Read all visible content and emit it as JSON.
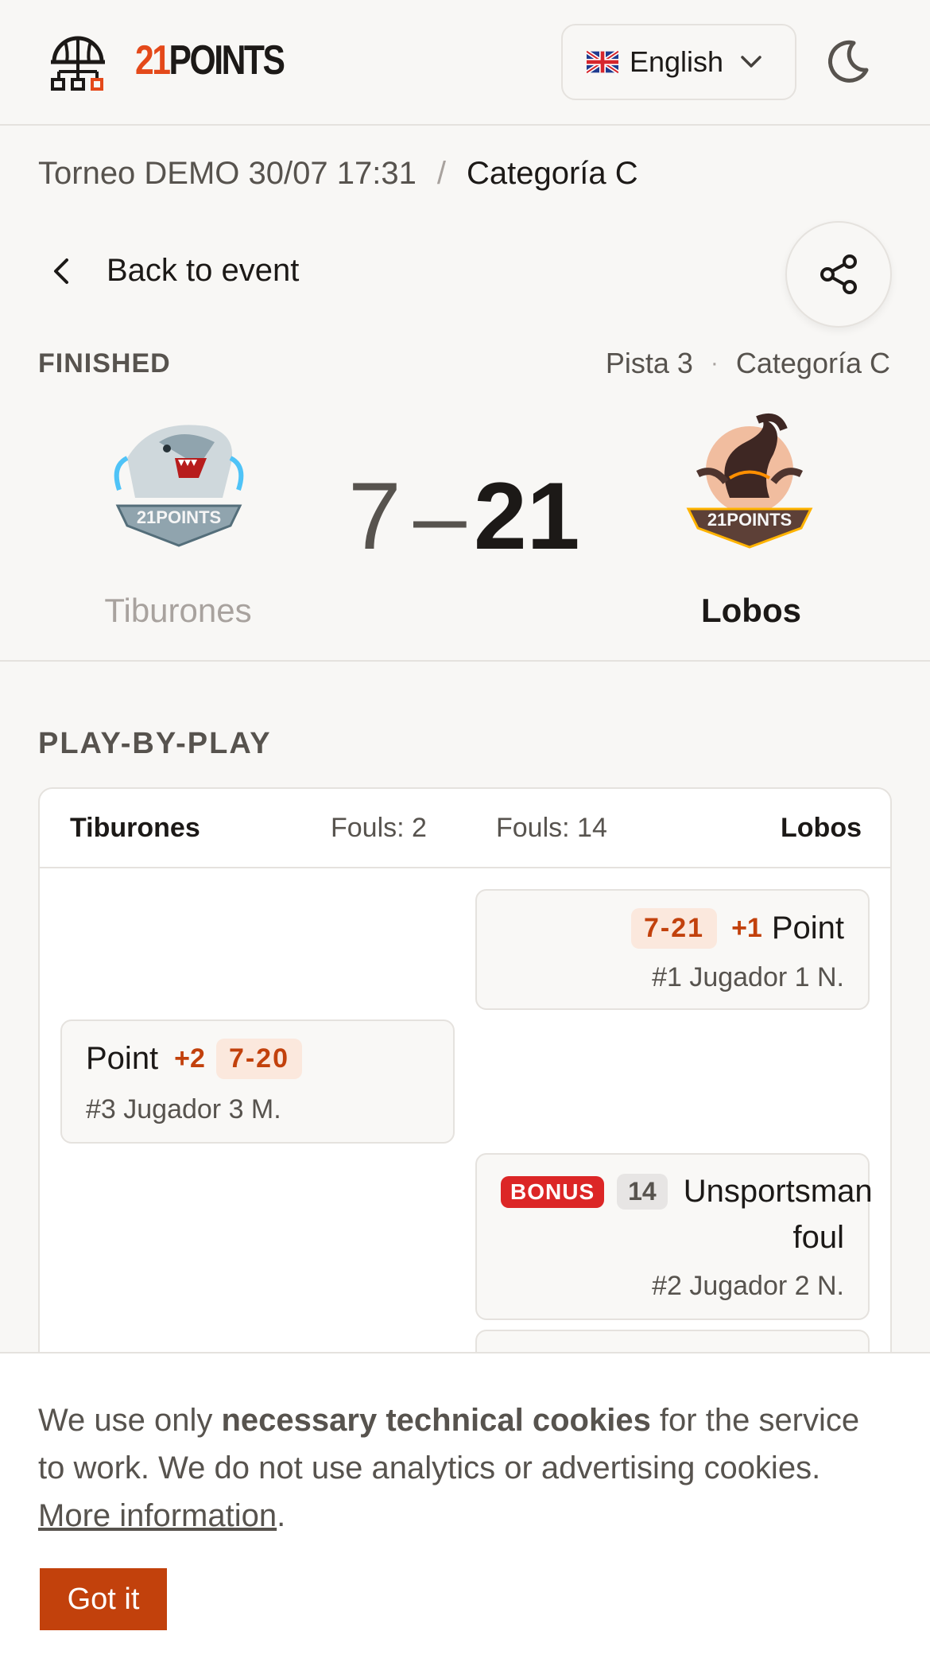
{
  "header": {
    "logo_accent": "21",
    "logo_rest": "POINTS",
    "language": "English"
  },
  "breadcrumb": {
    "event": "Torneo DEMO 30/07 17:31",
    "separator": "/",
    "category": "Categoría C"
  },
  "back_label": "Back to event",
  "match": {
    "status": "FINISHED",
    "court": "Pista 3",
    "meta_separator": "·",
    "category": "Categoría C",
    "home_team": "Tiburones",
    "away_team": "Lobos",
    "home_score": "7",
    "score_separator": "–",
    "away_score": "21",
    "home_logo_text": "21POINTS",
    "away_logo_text": "21POINTS"
  },
  "pbp": {
    "title": "PLAY-BY-PLAY",
    "home_team": "Tiburones",
    "away_team": "Lobos",
    "home_fouls": "Fouls: 2",
    "away_fouls": "Fouls: 14",
    "events": [
      {
        "side": "away",
        "score": "7-21",
        "points": "+1",
        "type": "Point",
        "player": "#1 Jugador 1 N."
      },
      {
        "side": "home",
        "score": "7-20",
        "points": "+2",
        "type": "Point",
        "player": "#3 Jugador 3 M."
      },
      {
        "side": "away",
        "bonus": "BONUS",
        "foul_count": "14",
        "type_line1": "Unsportsman",
        "type_line2": "foul",
        "player": "#2 Jugador 2 N."
      }
    ]
  },
  "cookie": {
    "text_before": "We use only ",
    "text_bold": "necessary technical cookies",
    "text_after": " for the service to work. We do not use analytics or advertising cookies. ",
    "link": "More information",
    "period": ".",
    "button": "Got it"
  },
  "colors": {
    "accent": "#c2410c",
    "brand_orange": "#e4491a",
    "bonus_red": "#dc2626",
    "background": "#f8f7f5"
  },
  "icons": {
    "logo": "basketball-hoop-bracket-icon",
    "flag": "uk-flag-icon",
    "dropdown": "chevron-down-icon",
    "theme": "moon-icon",
    "back": "chevron-left-icon",
    "share": "share-icon"
  }
}
